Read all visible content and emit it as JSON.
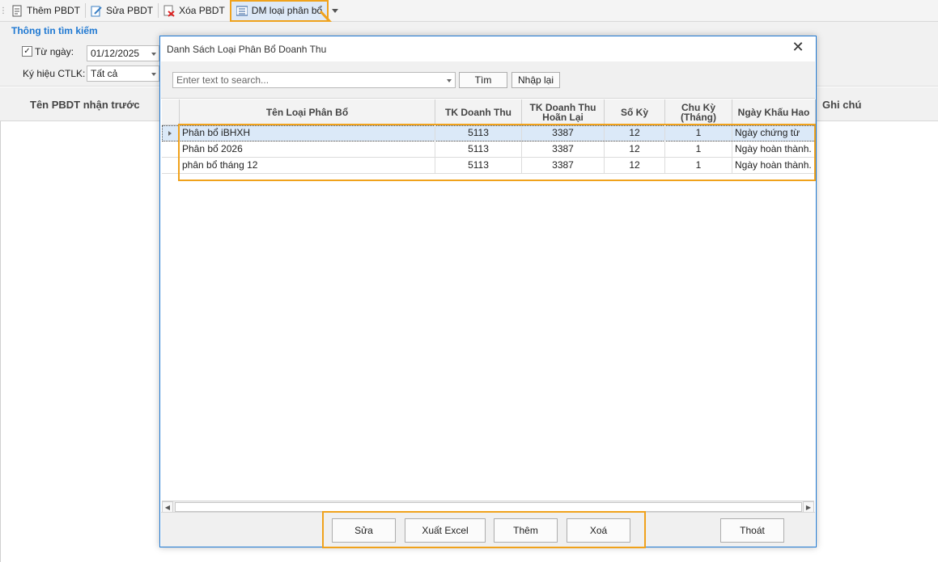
{
  "toolbar": {
    "add": "Thêm PBDT",
    "edit": "Sửa PBDT",
    "delete": "Xóa PBDT",
    "category": "DM loại phân bổ"
  },
  "search": {
    "title": "Thông tin tìm kiếm",
    "from_date_label": "Từ ngày:",
    "from_date_value": "01/12/2025",
    "symbol_label": "Ký hiệu CTLK:",
    "symbol_value": "Tất cả"
  },
  "background_grid": {
    "col_name": "Tên PBDT nhận trước",
    "col_note": "Ghi chú"
  },
  "dialog": {
    "title": "Danh Sách Loại Phân Bổ Doanh Thu",
    "close_glyph": "✕",
    "search_placeholder": "Enter text to search...",
    "find_button": "Tìm",
    "reset_button": "Nhập lại",
    "columns": {
      "name": "Tên Loại Phân Bổ",
      "revenue_acct": "TK Doanh Thu",
      "deferred_acct": "TK Doanh Thu Hoãn Lại",
      "periods": "Số Kỳ",
      "cycle": "Chu Kỳ (Tháng)",
      "depr_date": "Ngày Khấu Hao"
    },
    "rows": [
      {
        "name": "Phân bổ iBHXH",
        "revenue_acct": "5113",
        "deferred_acct": "3387",
        "periods": "12",
        "cycle": "1",
        "depr_date": "Ngày chứng từ"
      },
      {
        "name": "Phân bổ 2026",
        "revenue_acct": "5113",
        "deferred_acct": "3387",
        "periods": "12",
        "cycle": "1",
        "depr_date": "Ngày hoàn thành."
      },
      {
        "name": "phân bổ tháng 12",
        "revenue_acct": "5113",
        "deferred_acct": "3387",
        "periods": "12",
        "cycle": "1",
        "depr_date": "Ngày hoàn thành."
      }
    ],
    "footer": {
      "edit": "Sửa",
      "export": "Xuất Excel",
      "add": "Thêm",
      "delete": "Xoá",
      "exit": "Thoát"
    }
  },
  "colors": {
    "highlight": "#f0a21c",
    "accent": "#1e78d2",
    "selected_row": "#dbe9f8"
  }
}
